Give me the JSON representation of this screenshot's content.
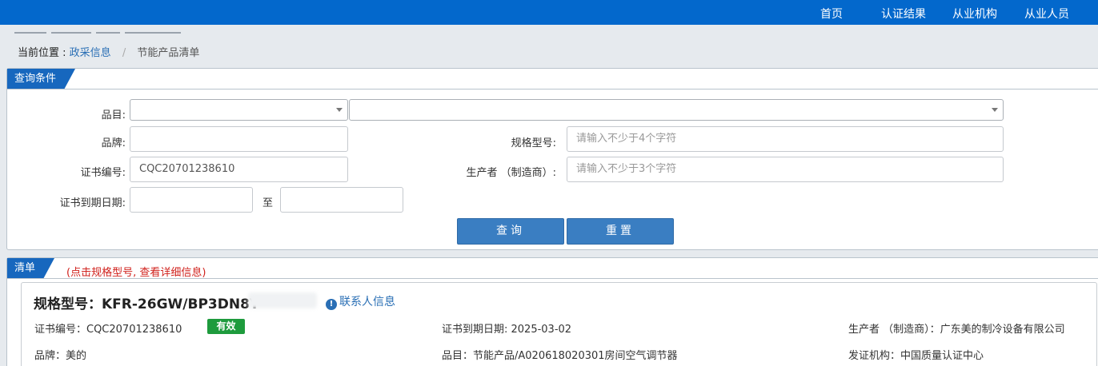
{
  "nav": {
    "items": [
      "首页",
      "认证结果",
      "从业机构",
      "从业人员"
    ]
  },
  "breadcrumb": {
    "label": "当前位置 :",
    "link": "政采信息",
    "separator": "/",
    "current": "节能产品清单"
  },
  "query_panel": {
    "title": "查询条件",
    "category_label": "品目:",
    "brand_label": "品牌:",
    "brand_value": "",
    "model_label": "规格型号:",
    "model_placeholder": "请输入不少于4个字符",
    "cert_no_label": "证书编号:",
    "cert_no_value": "CQC20701238610",
    "maker_label": "生产者 （制造商）:",
    "maker_placeholder": "请输入不少于3个字符",
    "expiry_label": "证书到期日期:",
    "date_sep": "至",
    "search_button": "查询",
    "reset_button": "重置"
  },
  "list_panel": {
    "title": "清单",
    "hint": "(点击规格型号, 查看详细信息)",
    "result": {
      "model_title": "规格型号：KFR-26GW/BP3DN8Y",
      "contact_link": "联系人信息",
      "cert_no": "证书编号：CQC20701238610",
      "status": "有效",
      "expiry": "证书到期日期: 2025-03-02",
      "maker": "生产者 （制造商）：广东美的制冷设备有限公司",
      "brand": "品牌：美的",
      "category": "品目：节能产品/A020618020301房间空气调节器",
      "issuer": "发证机构：中国质量认证中心"
    }
  },
  "colors": {
    "topbar": "#0368cc",
    "tab": "#1767be",
    "button": "#3a7ec2",
    "badge": "#1e9b3d",
    "hint": "#d0211c",
    "link": "#2a6fb5"
  }
}
